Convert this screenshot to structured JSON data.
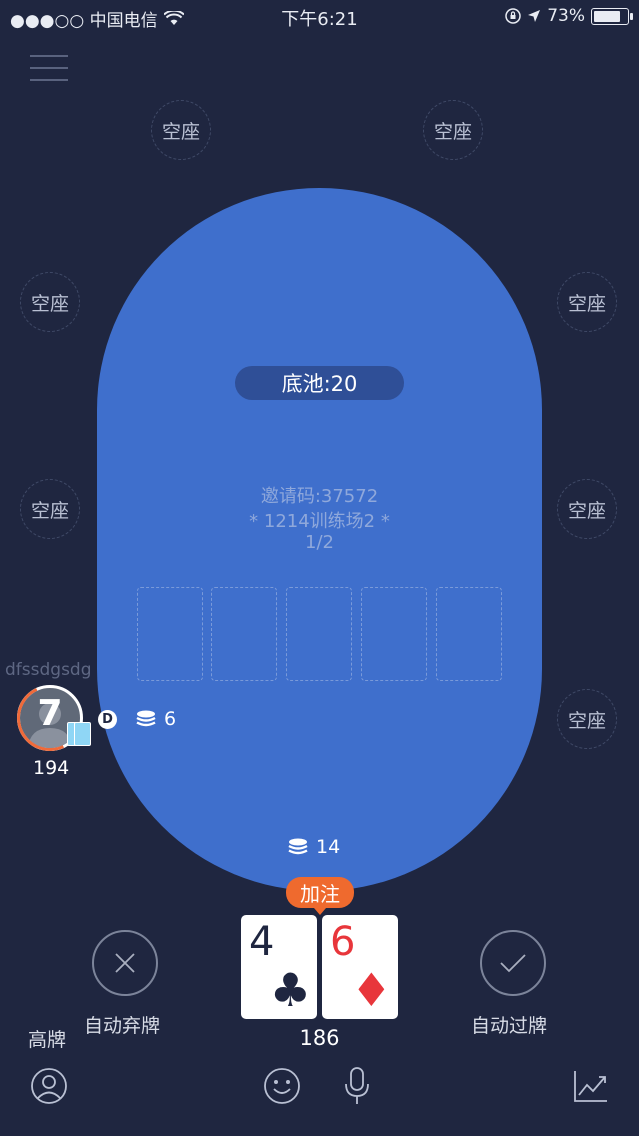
{
  "status_bar": {
    "carrier": "●●●○○ 中国电信",
    "time": "下午6:21",
    "battery": "73%",
    "battery_level": 0.73
  },
  "seats": [
    "空座",
    "空座",
    "空座",
    "空座",
    "空座",
    "空座",
    "空座"
  ],
  "table": {
    "pot": "底池:20",
    "invite": "邀请码:37572",
    "room": "* 1214训练场2 *",
    "blinds": "1/2"
  },
  "player": {
    "name": "dfssdgsdg",
    "timer": "7",
    "chips": "194",
    "dealer": "D",
    "bet": "6"
  },
  "center_bet": "14",
  "action_tag": "加注",
  "hand": {
    "cards": [
      {
        "rank": "4",
        "suit": "♣",
        "color": "#1f2640"
      },
      {
        "rank": "6",
        "suit": "♦",
        "color": "#e8363b"
      }
    ],
    "chips": "186",
    "hand_type": "高牌"
  },
  "actions": {
    "fold": "自动弃牌",
    "check": "自动过牌"
  },
  "colors": {
    "background": "#1f2640",
    "table": "#3f6fcc",
    "accent": "#ef6a2e"
  },
  "icons": [
    "menu-icon",
    "wifi-icon",
    "lock-icon",
    "location-icon",
    "close-icon",
    "check-icon",
    "profile-icon",
    "emoji-icon",
    "microphone-icon",
    "chart-icon"
  ]
}
